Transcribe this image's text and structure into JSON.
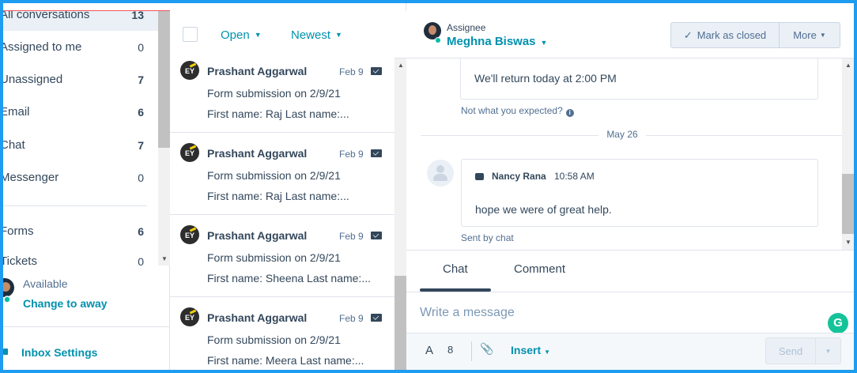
{
  "sidebar": {
    "items": [
      {
        "label": "All conversations",
        "count": "13"
      },
      {
        "label": "Assigned to me",
        "count": "0"
      },
      {
        "label": "Unassigned",
        "count": "7"
      },
      {
        "label": "Email",
        "count": "6"
      },
      {
        "label": "Chat",
        "count": "7"
      },
      {
        "label": "Messenger",
        "count": "0"
      },
      {
        "label": "Forms",
        "count": "6"
      },
      {
        "label": "Tickets",
        "count": "0"
      }
    ],
    "status_label": "Available",
    "status_action": "Change to away",
    "settings_label": "Inbox Settings"
  },
  "list": {
    "filter_status": "Open",
    "filter_sort": "Newest",
    "conversations": [
      {
        "avatar": "EY",
        "name": "Prashant Aggarwal",
        "date": "Feb 9",
        "subject": "Form submission on 2/9/21",
        "preview": "First name: Raj Last name:..."
      },
      {
        "avatar": "EY",
        "name": "Prashant Aggarwal",
        "date": "Feb 9",
        "subject": "Form submission on 2/9/21",
        "preview": "First name: Raj Last name:..."
      },
      {
        "avatar": "EY",
        "name": "Prashant Aggarwal",
        "date": "Feb 9",
        "subject": "Form submission on 2/9/21",
        "preview": "First name: Sheena Last name:..."
      },
      {
        "avatar": "EY",
        "name": "Prashant Aggarwal",
        "date": "Feb 9",
        "subject": "Form submission on 2/9/21",
        "preview": "First name: Meera Last name:..."
      }
    ]
  },
  "thread": {
    "assignee_label": "Assignee",
    "assignee_name": "Meghna Biswas",
    "mark_closed_label": "Mark as closed",
    "more_label": "More",
    "messages": {
      "auto_reply": "We'll return today at 2:00 PM",
      "not_expected": "Not what you expected?",
      "date_separator": "May 26",
      "sender": "Nancy Rana",
      "time": "10:58 AM",
      "body": "hope we were of great help.",
      "sent_by": "Sent by chat"
    }
  },
  "composer": {
    "tabs": [
      "Chat",
      "Comment"
    ],
    "placeholder": "Write a message",
    "insert_label": "Insert",
    "send_label": "Send",
    "grammarly": "G"
  },
  "colors": {
    "accent": "#0091ae",
    "frame": "#1e9cf0",
    "available": "#00bda5",
    "grammarly": "#15c39a"
  }
}
